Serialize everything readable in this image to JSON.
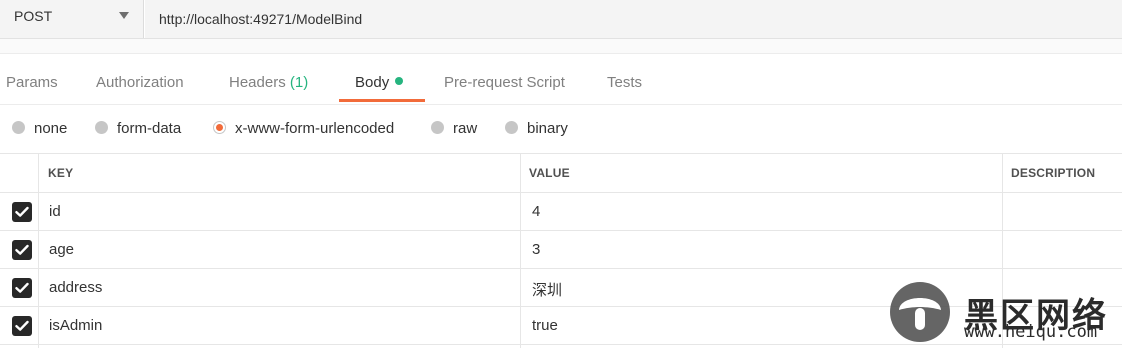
{
  "request": {
    "method": "POST",
    "url": "http://localhost:49271/ModelBind"
  },
  "tabs": [
    {
      "label": "Params"
    },
    {
      "label": "Authorization"
    },
    {
      "label": "Headers",
      "count": "(1)"
    },
    {
      "label": "Body",
      "active": true
    },
    {
      "label": "Pre-request Script"
    },
    {
      "label": "Tests"
    }
  ],
  "body_types": [
    {
      "label": "none",
      "selected": false
    },
    {
      "label": "form-data",
      "selected": false
    },
    {
      "label": "x-www-form-urlencoded",
      "selected": true
    },
    {
      "label": "raw",
      "selected": false
    },
    {
      "label": "binary",
      "selected": false
    }
  ],
  "table": {
    "headers": {
      "key": "KEY",
      "value": "VALUE",
      "description": "DESCRIPTION"
    },
    "rows": [
      {
        "checked": true,
        "key": "id",
        "value": "4",
        "description": ""
      },
      {
        "checked": true,
        "key": "age",
        "value": "3",
        "description": ""
      },
      {
        "checked": true,
        "key": "address",
        "value": "深圳",
        "description": ""
      },
      {
        "checked": true,
        "key": "isAdmin",
        "value": "true",
        "description": ""
      }
    ]
  },
  "watermark": {
    "text_cn": "黑区网络",
    "text_en": "www.heiqu.com"
  },
  "colors": {
    "accent": "#f26b3a",
    "green": "#26b47f",
    "checkbox": "#282828"
  },
  "icons": {
    "method_dropdown": "chevron-down-icon",
    "row_checkbox": "checkmark-icon",
    "body_indicator": "dot-icon"
  }
}
